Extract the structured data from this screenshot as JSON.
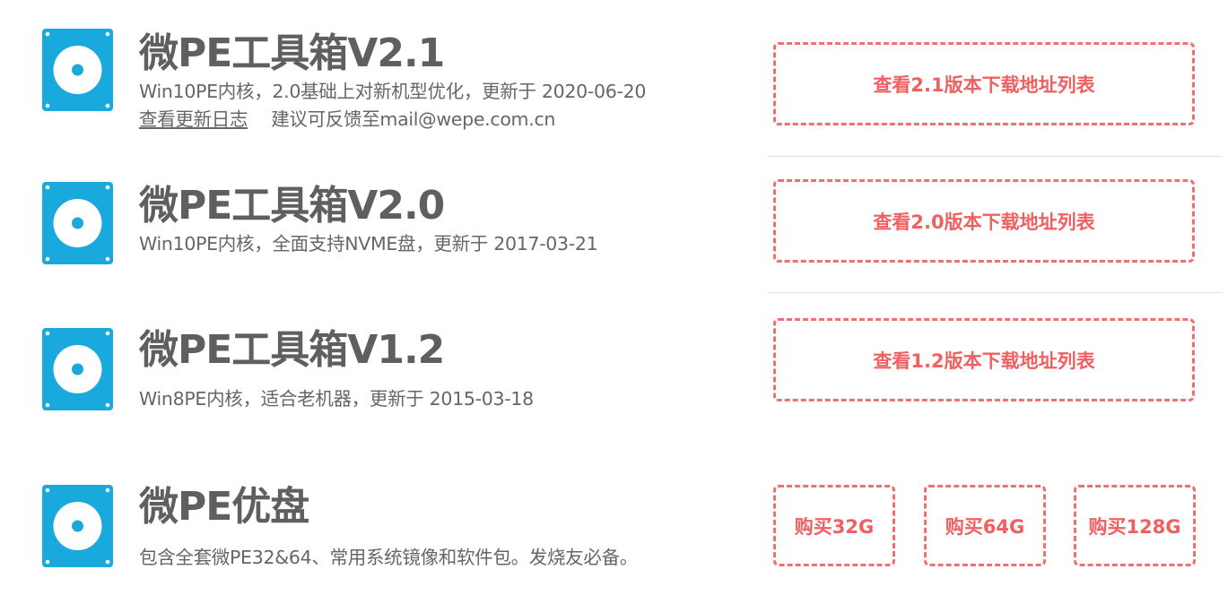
{
  "products": [
    {
      "title": "微PE工具箱V2.1",
      "description": "Win10PE内核，2.0基础上对新机型优化，更新于 2020-06-20",
      "changelog_link": "查看更新日志",
      "feedback": "建议可反馈至mail@wepe.com.cn",
      "button_label": "查看2.1版本下载地址列表",
      "icon": "disc-icon"
    },
    {
      "title": "微PE工具箱V2.0",
      "description": "Win10PE内核，全面支持NVME盘，更新于 2017-03-21",
      "button_label": "查看2.0版本下载地址列表",
      "icon": "disc-icon"
    },
    {
      "title": "微PE工具箱V1.2",
      "description": "Win8PE内核，适合老机器，更新于 2015-03-18",
      "button_label": "查看1.2版本下载地址列表",
      "icon": "disc-icon"
    },
    {
      "title": "微PE优盘",
      "description": "包含全套微PE32&64、常用系统镜像和软件包。发烧友必备。",
      "buy_options": [
        "购买32G",
        "购买64G",
        "购买128G"
      ],
      "icon": "disc-icon"
    }
  ],
  "colors": {
    "icon_blue": "#1aa9dc",
    "accent_red": "#f06060",
    "title_gray": "#5f5f5f",
    "text_gray": "#666666"
  }
}
